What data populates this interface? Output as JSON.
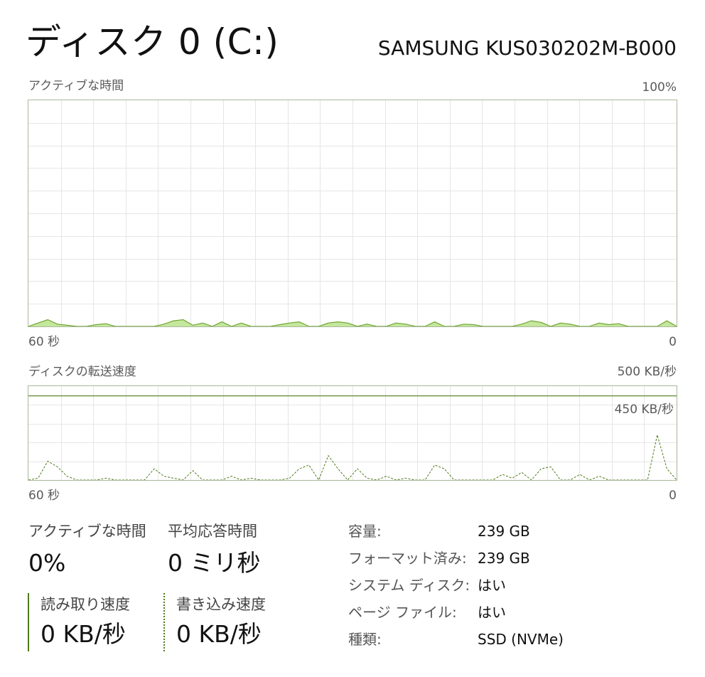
{
  "header": {
    "title": "ディスク 0 (C:)",
    "model": "SAMSUNG KUS030202M-B000"
  },
  "active_time_chart": {
    "label": "アクティブな時間",
    "max_label": "100%",
    "time_left_label": "60 秒",
    "time_right_label": "0"
  },
  "transfer_chart": {
    "label": "ディスクの転送速度",
    "max_label": "500 KB/秒",
    "line_label": "450 KB/秒",
    "time_left_label": "60 秒",
    "time_right_label": "0"
  },
  "stats": {
    "active_time_label": "アクティブな時間",
    "active_time_value": "0%",
    "avg_response_label": "平均応答時間",
    "avg_response_value": "0 ミリ秒",
    "read_speed_label": "読み取り速度",
    "read_speed_value": "0 KB/秒",
    "write_speed_label": "書き込み速度",
    "write_speed_value": "0 KB/秒"
  },
  "properties": [
    {
      "label": "容量:",
      "value": "239 GB"
    },
    {
      "label": "フォーマット済み:",
      "value": "239 GB"
    },
    {
      "label": "システム ディスク:",
      "value": "はい"
    },
    {
      "label": "ページ ファイル:",
      "value": "はい"
    },
    {
      "label": "種類:",
      "value": "SSD (NVMe)"
    }
  ],
  "colors": {
    "chart_border": "#a9b89a",
    "grid": "#e6e6e6",
    "area_fill": "#c4e79c",
    "area_stroke": "#6fa534",
    "line_dark": "#4f7a1a"
  },
  "chart_data": [
    {
      "type": "area",
      "x_range": [
        60,
        0
      ],
      "ylim": [
        0,
        100
      ],
      "grid": true,
      "values": [
        0,
        1.5,
        3,
        1,
        0.5,
        0,
        0,
        0.8,
        1.2,
        0,
        0,
        0,
        0,
        0,
        1,
        2.5,
        3,
        0.5,
        1.5,
        0,
        2,
        0,
        1.5,
        0,
        0,
        0,
        0.8,
        1.5,
        2,
        0,
        0,
        1.5,
        2,
        1.5,
        0,
        1,
        0,
        0,
        1.5,
        1,
        0,
        0,
        2,
        0,
        0,
        1,
        0.8,
        0,
        0,
        0,
        0,
        1,
        2.5,
        1.8,
        0,
        1.5,
        1,
        0,
        0,
        1.5,
        0.8,
        1.2,
        0,
        0,
        0,
        0,
        2.5,
        0
      ]
    },
    {
      "type": "line",
      "x_range": [
        60,
        0
      ],
      "ylim": [
        0,
        500
      ],
      "reference_line": 450,
      "grid": true,
      "values": [
        0,
        10,
        100,
        70,
        20,
        0,
        0,
        0,
        10,
        0,
        0,
        0,
        0,
        60,
        20,
        10,
        0,
        50,
        0,
        0,
        0,
        20,
        0,
        10,
        0,
        0,
        0,
        10,
        60,
        80,
        0,
        130,
        60,
        0,
        60,
        10,
        0,
        20,
        0,
        10,
        0,
        0,
        80,
        60,
        0,
        0,
        0,
        0,
        0,
        30,
        10,
        40,
        0,
        60,
        70,
        0,
        0,
        30,
        0,
        20,
        0,
        0,
        0,
        0,
        0,
        240,
        60,
        0
      ]
    }
  ]
}
